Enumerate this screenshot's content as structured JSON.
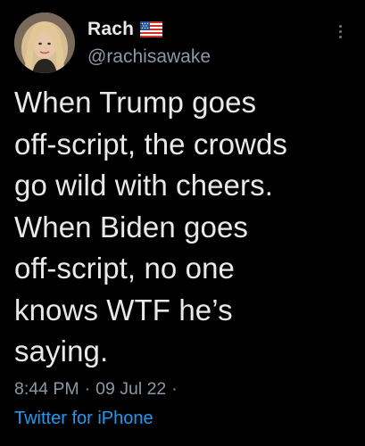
{
  "tweet": {
    "author": {
      "display_name": "Rach",
      "handle": "@rachisawake",
      "flag_icon": "us-flag-emoji"
    },
    "text_lines": [
      "When Trump goes",
      "off-script, the crowds",
      "go wild with cheers.",
      "When Biden goes",
      "off-script, no one",
      "knows WTF he’s",
      "saying."
    ],
    "time": "8:44 PM",
    "date": "09 Jul 22",
    "separator": "·",
    "source": "Twitter for iPhone",
    "more_icon": "more-vertical-icon"
  },
  "colors": {
    "background": "#000000",
    "primary_text": "#e7e9ea",
    "secondary_text": "#8b98a5",
    "link": "#1d9bf0"
  }
}
